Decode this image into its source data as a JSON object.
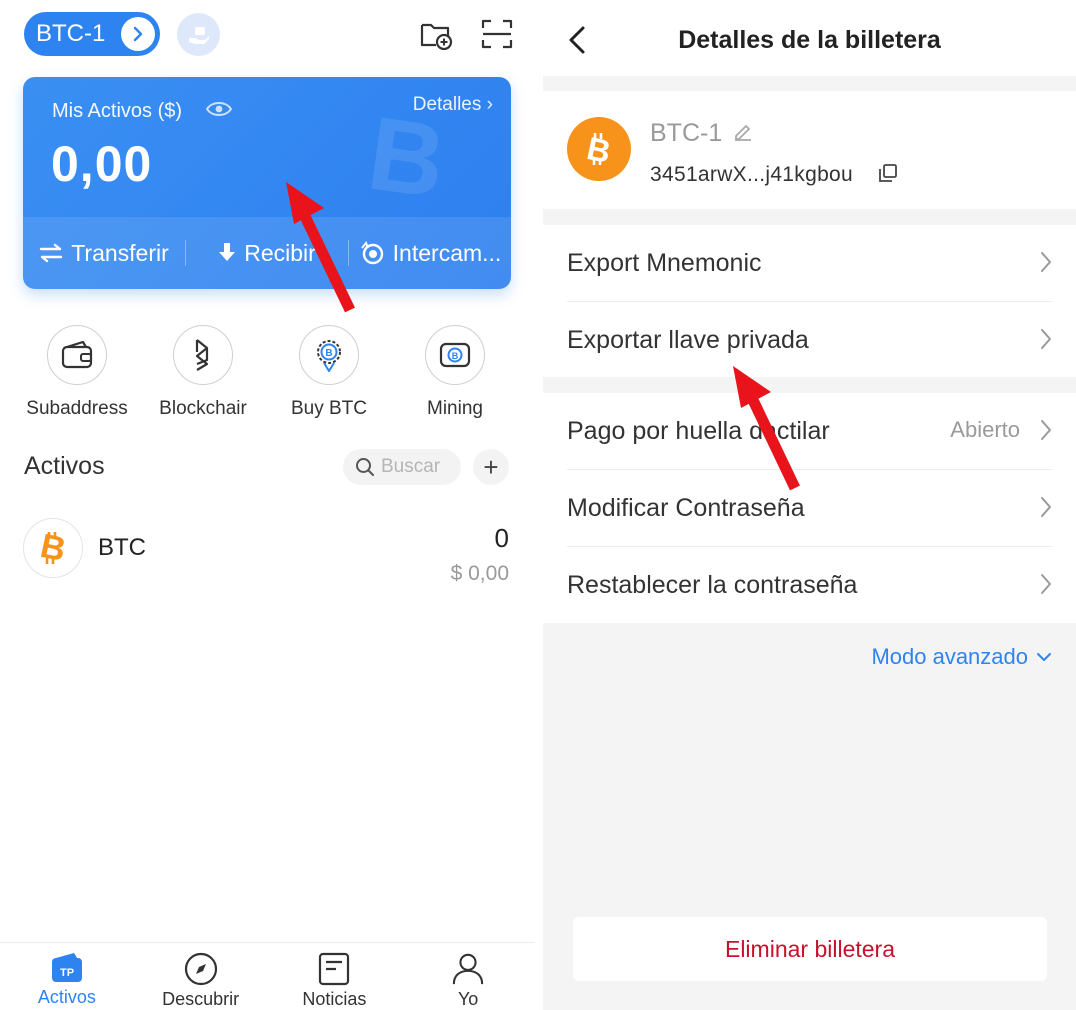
{
  "left": {
    "wallet_name": "BTC-1",
    "card": {
      "label": "Mis Activos ($)",
      "details": "Detalles",
      "balance": "0,00",
      "watermark": "B",
      "actions": [
        "Transferir",
        "Recibir",
        "Intercam..."
      ]
    },
    "quick_actions": [
      {
        "label": "Subaddress",
        "icon": "wallet-card-icon"
      },
      {
        "label": "Blockchair",
        "icon": "blockchair-icon"
      },
      {
        "label": "Buy BTC",
        "icon": "bitcoin-badge-icon"
      },
      {
        "label": "Mining",
        "icon": "mining-chip-icon"
      }
    ],
    "assets_title": "Activos",
    "search_placeholder": "Buscar",
    "add_label": "+",
    "coin": {
      "name": "BTC",
      "amount": "0",
      "value": "$ 0,00"
    },
    "nav": [
      {
        "label": "Activos",
        "icon": "tp-wallet-icon",
        "active": true
      },
      {
        "label": "Descubrir",
        "icon": "compass-icon",
        "active": false
      },
      {
        "label": "Noticias",
        "icon": "news-icon",
        "active": false
      },
      {
        "label": "Yo",
        "icon": "user-icon",
        "active": false
      }
    ]
  },
  "right": {
    "title": "Detalles de la billetera",
    "wallet_name": "BTC-1",
    "address": "3451arwX...j41kgbou",
    "rows_group1": [
      "Export Mnemonic",
      "Exportar llave privada"
    ],
    "rows_group2": [
      {
        "label": "Pago por huella dactilar",
        "value": "Abierto"
      },
      {
        "label": "Modificar Contraseña",
        "value": ""
      },
      {
        "label": "Restablecer la contraseña",
        "value": ""
      }
    ],
    "advanced_mode": "Modo avanzado",
    "delete": "Eliminar billetera"
  },
  "colors": {
    "accent": "#2d84f0",
    "btc": "#f7931a",
    "danger": "#c8102e",
    "annotation": "#e8131b"
  }
}
